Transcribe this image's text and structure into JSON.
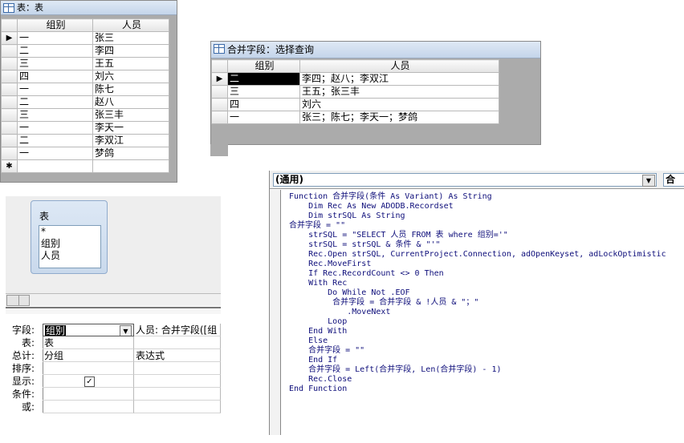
{
  "table_window": {
    "title": "表：表",
    "columns": [
      "组别",
      "人员"
    ],
    "rows": [
      [
        "一",
        "张三"
      ],
      [
        "二",
        "李四"
      ],
      [
        "三",
        "王五"
      ],
      [
        "四",
        "刘六"
      ],
      [
        "一",
        "陈七"
      ],
      [
        "二",
        "赵八"
      ],
      [
        "三",
        "张三丰"
      ],
      [
        "一",
        "李天一"
      ],
      [
        "二",
        "李双江"
      ],
      [
        "一",
        "梦鸽"
      ]
    ],
    "current_marker": "▶",
    "new_marker": "✱"
  },
  "query_window": {
    "title": "合并字段：选择查询",
    "columns": [
      "组别",
      "人员"
    ],
    "rows": [
      [
        "二",
        "李四；赵八；李双江"
      ],
      [
        "三",
        "王五；张三丰"
      ],
      [
        "四",
        "刘六"
      ],
      [
        "一",
        "张三；陈七；李天一；梦鸽"
      ]
    ],
    "current_marker": "▶"
  },
  "designer": {
    "table_box": {
      "title": "表",
      "fields": [
        "*",
        "组别",
        "人员"
      ]
    },
    "row_labels": [
      "字段:",
      "表:",
      "总计:",
      "排序:",
      "显示:",
      "条件:",
      "或:"
    ],
    "col1": {
      "field": "组别",
      "table": "表",
      "total": "分组",
      "show_checked": "✓"
    },
    "col2": {
      "field": "人员: 合并字段([组",
      "total": "表达式"
    }
  },
  "code_window": {
    "object_combo": "(通用)",
    "proc_combo": "合",
    "lines": [
      "Function 合并字段(条件 As Variant) As String",
      "    Dim Rec As New ADODB.Recordset",
      "    Dim strSQL As String",
      "合并字段 = \"\"",
      "    strSQL = \"SELECT 人员 FROM 表 where 组别='\"",
      "    strSQL = strSQL & 条件 & \"'\"",
      "    Rec.Open strSQL, CurrentProject.Connection, adOpenKeyset, adLockOptimistic",
      "    Rec.MoveFirst",
      "    If Rec.RecordCount <> 0 Then",
      "    With Rec",
      "        Do While Not .EOF",
      "         合并字段 = 合并字段 & !人员 & \"；\"",
      "            .MoveNext",
      "        Loop",
      "    End With",
      "    Else",
      "    合并字段 = \"\"",
      "    End If",
      "    合并字段 = Left(合并字段, Len(合并字段) - 1)",
      "    Rec.Close",
      "End Function"
    ]
  }
}
